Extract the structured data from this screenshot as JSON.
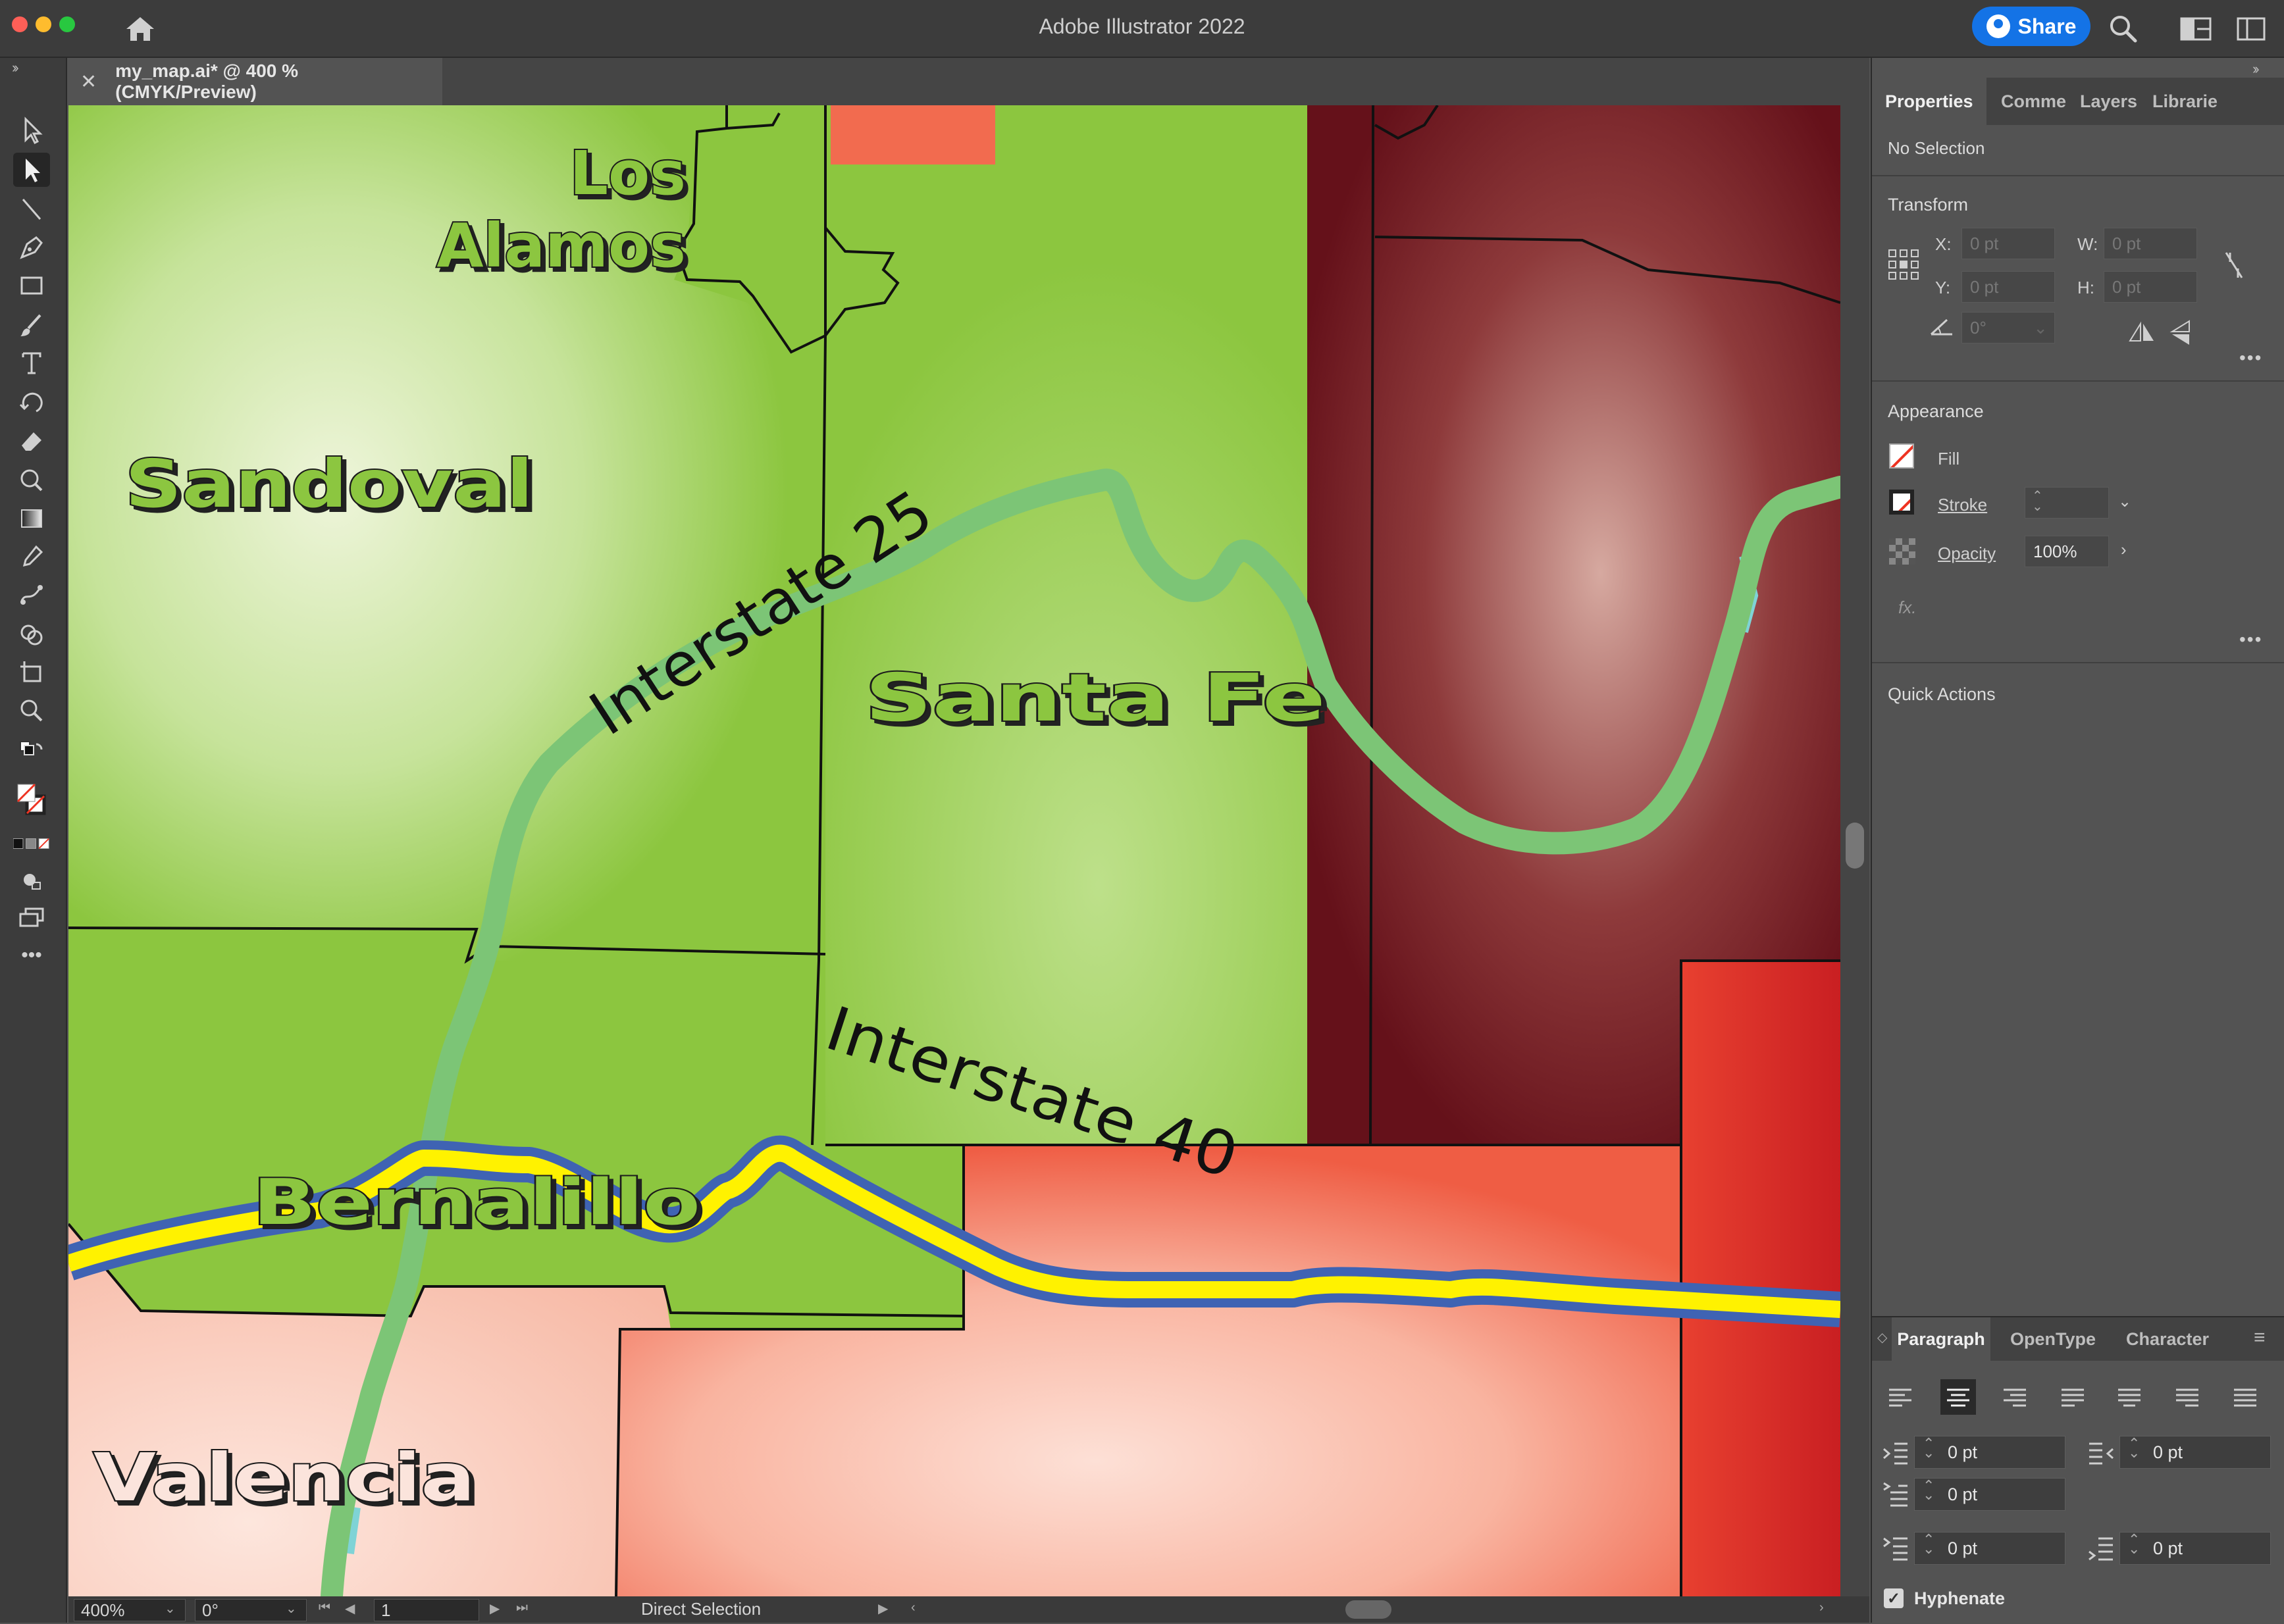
{
  "app": {
    "title": "Adobe Illustrator 2022",
    "share_label": "Share",
    "document_tab": "my_map.ai* @ 400 % (CMYK/Preview)",
    "close_tab_label": "✕"
  },
  "map": {
    "county_labels": [
      "Los",
      "Alamos",
      "Sandoval",
      "Santa Fe",
      "Bernalillo",
      "Valencia"
    ],
    "road_labels": [
      "Interstate 25",
      "Interstate 40"
    ]
  },
  "status_bar": {
    "zoom": "400%",
    "rotation": "0°",
    "artboard": "1",
    "tool_name": "Direct Selection"
  },
  "right_panel": {
    "tabs": [
      "Properties",
      "Comme",
      "Layers",
      "Librarie"
    ],
    "selection_state": "No Selection",
    "transform": {
      "title": "Transform",
      "x_label": "X:",
      "y_label": "Y:",
      "w_label": "W:",
      "h_label": "H:",
      "x_value": "0 pt",
      "y_value": "0 pt",
      "w_value": "0 pt",
      "h_value": "0 pt",
      "angle_value": "0°"
    },
    "appearance": {
      "title": "Appearance",
      "fill_label": "Fill",
      "stroke_label": "Stroke",
      "opacity_label": "Opacity",
      "opacity_value": "100%",
      "fx_label": "fx."
    },
    "quick_actions_title": "Quick Actions",
    "more_label": "•••"
  },
  "paragraph_panel": {
    "tabs": [
      "Paragraph",
      "OpenType",
      "Character"
    ],
    "left_indent": "0 pt",
    "right_indent": "0 pt",
    "first_line_indent": "0 pt",
    "space_before": "0 pt",
    "space_after": "0 pt",
    "hyphenate_label": "Hyphenate",
    "hyphenate_checked": "✓"
  },
  "toolbar": {
    "more_label": "•••",
    "expand_label": "››"
  },
  "colors": {
    "accent": "#1473e6",
    "county_green": "#8cc63f",
    "county_red": "#f26b4f",
    "county_maroon": "#6b0f19",
    "interstate_25": "#7cc576",
    "interstate_40_fill": "#fff200",
    "interstate_40_edge": "#3f63b3"
  }
}
